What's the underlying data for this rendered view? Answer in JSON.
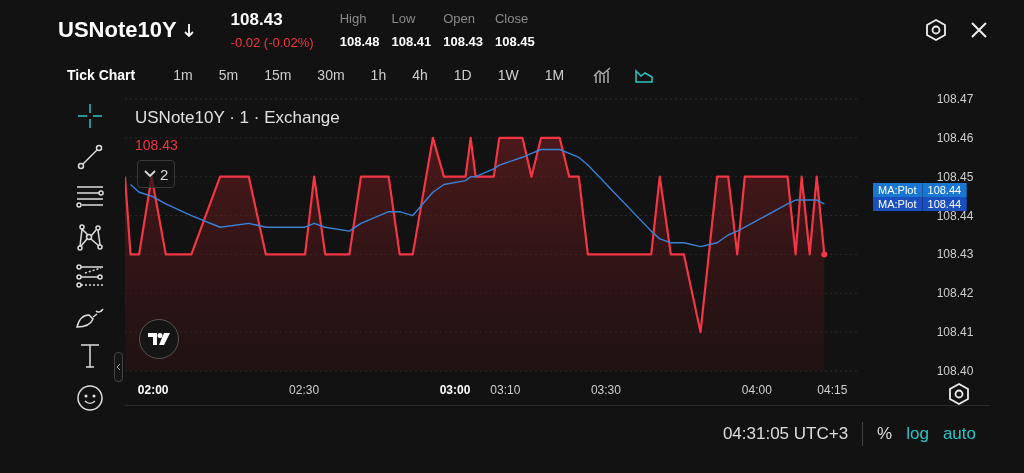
{
  "header": {
    "symbol": "USNote10Y",
    "price": "108.43",
    "change": "-0.02 (-0.02%)",
    "stats": [
      {
        "label": "High",
        "value": "108.48"
      },
      {
        "label": "Low",
        "value": "108.41"
      },
      {
        "label": "Open",
        "value": "108.43"
      },
      {
        "label": "Close",
        "value": "108.45"
      }
    ]
  },
  "intervals": [
    {
      "label": "Tick Chart",
      "selected": true
    },
    {
      "label": "1m",
      "selected": false
    },
    {
      "label": "5m",
      "selected": false
    },
    {
      "label": "15m",
      "selected": false
    },
    {
      "label": "30m",
      "selected": false
    },
    {
      "label": "1h",
      "selected": false
    },
    {
      "label": "4h",
      "selected": false
    },
    {
      "label": "1D",
      "selected": false
    },
    {
      "label": "1W",
      "selected": false
    },
    {
      "label": "1M",
      "selected": false
    }
  ],
  "chart_types": [
    {
      "kind": "bars",
      "selected": false
    },
    {
      "kind": "area",
      "selected": true
    }
  ],
  "tools": [
    {
      "kind": "crosshair",
      "selected": true
    },
    {
      "kind": "trend-line",
      "selected": false
    },
    {
      "kind": "fib",
      "selected": false
    },
    {
      "kind": "pattern",
      "selected": false
    },
    {
      "kind": "forecast",
      "selected": false
    },
    {
      "kind": "brush",
      "selected": false
    },
    {
      "kind": "text",
      "selected": false
    },
    {
      "kind": "emoji",
      "selected": false
    }
  ],
  "chart": {
    "legend": "· 1 · Exchange",
    "last_price": "108.43",
    "indicators_count": "2",
    "tags": [
      {
        "value": "108.44",
        "color": "#1976d2"
      },
      {
        "value": "108.44",
        "color": "#1a4fc0"
      }
    ],
    "chart_data": {
      "type": "area",
      "x": [
        114.4,
        115.5,
        117.2,
        119.7,
        122.5,
        127.6,
        133.3,
        139.0,
        142.4,
        150.2,
        152.0,
        154.2,
        159.0,
        161.3,
        166.8,
        169.0,
        171.6,
        175.6,
        177.8,
        182.1,
        183.1,
        184.1,
        187.7,
        188.8,
        193.4,
        195.2,
        197.1,
        200.8,
        202.7,
        204.6,
        206.4,
        219.0,
        220.7,
        222.9,
        225.5,
        228.8,
        232.1,
        234.3,
        236.1,
        237.6,
        246.1,
        247.7,
        248.9,
        250.5,
        251.9,
        253.4
      ],
      "series": [
        {
          "name": "USNote10Y",
          "type": "area",
          "color": "#f23645",
          "values": [
            108.45,
            108.43,
            108.43,
            108.45,
            108.43,
            108.43,
            108.45,
            108.45,
            108.43,
            108.43,
            108.45,
            108.43,
            108.43,
            108.45,
            108.45,
            108.43,
            108.43,
            108.46,
            108.45,
            108.45,
            108.46,
            108.45,
            108.45,
            108.46,
            108.46,
            108.45,
            108.46,
            108.46,
            108.45,
            108.45,
            108.43,
            108.43,
            108.45,
            108.43,
            108.43,
            108.41,
            108.45,
            108.45,
            108.43,
            108.45,
            108.45,
            108.43,
            108.45,
            108.43,
            108.45,
            108.43
          ]
        },
        {
          "name": "MA:Plot",
          "type": "line",
          "color": "#3b82d6",
          "values": [
            null,
            108.448,
            108.446,
            108.445,
            108.443,
            108.44,
            108.437,
            108.438,
            108.437,
            108.437,
            108.438,
            108.437,
            108.436,
            108.438,
            108.441,
            108.441,
            108.44,
            108.446,
            108.448,
            108.449,
            108.45,
            108.45,
            108.452,
            108.453,
            108.455,
            108.456,
            108.457,
            108.457,
            108.456,
            108.455,
            108.453,
            108.436,
            108.434,
            108.433,
            108.433,
            108.432,
            108.433,
            108.435,
            108.436,
            108.437,
            108.443,
            108.444,
            108.444,
            108.444,
            108.444,
            108.443
          ]
        }
      ],
      "grid": true,
      "xlim": [
        114.4,
        260.5
      ],
      "ylim": [
        108.4,
        108.47
      ],
      "xticks": [
        {
          "value": 120,
          "label": "02:00"
        },
        {
          "value": 150,
          "label": "02:30"
        },
        {
          "value": 180,
          "label": "03:00"
        },
        {
          "value": 190,
          "label": "03:10"
        },
        {
          "value": 210,
          "label": "03:30"
        },
        {
          "value": 240,
          "label": "04:00"
        },
        {
          "value": 255,
          "label": "04:15"
        }
      ],
      "yticks": [
        {
          "value": 108.4,
          "label": "108.40"
        },
        {
          "value": 108.41,
          "label": "108.41"
        },
        {
          "value": 108.42,
          "label": "108.42"
        },
        {
          "value": 108.43,
          "label": "108.43"
        },
        {
          "value": 108.44,
          "label": "108.44"
        },
        {
          "value": 108.45,
          "label": "108.45"
        },
        {
          "value": 108.46,
          "label": "108.46"
        },
        {
          "value": 108.47,
          "label": "108.47"
        }
      ]
    }
  },
  "status_bar": {
    "time": "04:31:05 UTC+3",
    "scale_options": [
      {
        "label": "%",
        "selected": false
      },
      {
        "label": "log",
        "selected": true
      },
      {
        "label": "auto",
        "selected": true
      }
    ]
  }
}
